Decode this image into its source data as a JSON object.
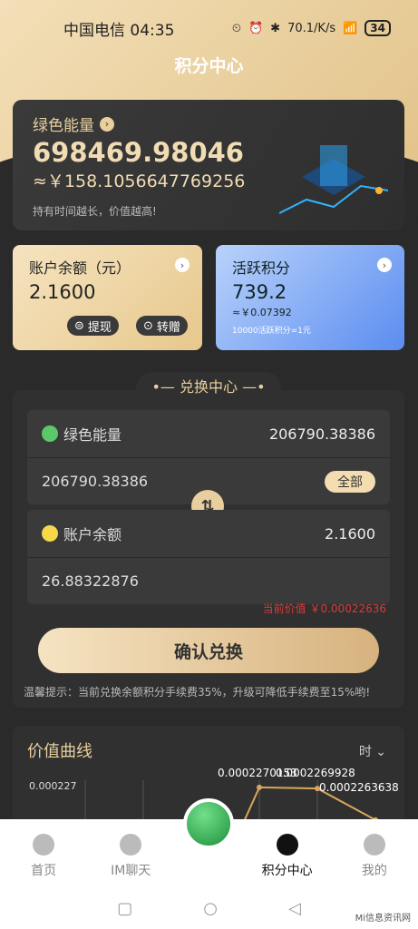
{
  "status": {
    "carrier_time": "中国电信 04:35",
    "net_speed_top": "70.1",
    "net_speed_bottom": "K/s",
    "battery": "34"
  },
  "header": {
    "title": "积分中心"
  },
  "energy": {
    "title": "绿色能量",
    "value": "698469.98046",
    "rmb": "≈￥158.1056647769256",
    "tip": "持有时间越长，价值越高!"
  },
  "balance": {
    "title": "账户余额（元）",
    "value": "2.1600",
    "withdraw": "提现",
    "transfer": "转赠"
  },
  "active": {
    "title": "活跃积分",
    "value": "739.2",
    "rmb": "≈￥0.07392",
    "foot": "10000活跃积分=1元"
  },
  "exchange": {
    "title": "•— 兑换中心 —•",
    "from_label": "绿色能量",
    "from_value": "206790.38386",
    "from_input": "206790.38386",
    "all_label": "全部",
    "to_label": "账户余额",
    "to_value": "2.1600",
    "to_input": "26.88322876",
    "price": "当前价值 ￥0.00022636",
    "confirm": "确认兑换",
    "tip": "温馨提示：当前兑换余额积分手续费35%，升级可降低手续费至15%哟!"
  },
  "chart": {
    "title": "价值曲线",
    "unit": "时",
    "y_tick": "0.000227",
    "labels": [
      "0.0002270153",
      "0.0002269928",
      "0.0002263638"
    ]
  },
  "chart_data": {
    "type": "line",
    "x": [
      1,
      2,
      3,
      4
    ],
    "values": [
      0.0002270153,
      0.0002270153,
      0.0002269928,
      0.0002263638
    ],
    "ylabel": "",
    "xlabel": ""
  },
  "nav": {
    "home": "首页",
    "im": "IM聊天",
    "points": "积分中心",
    "mine": "我的"
  },
  "watermark": "Mi信息资讯网"
}
